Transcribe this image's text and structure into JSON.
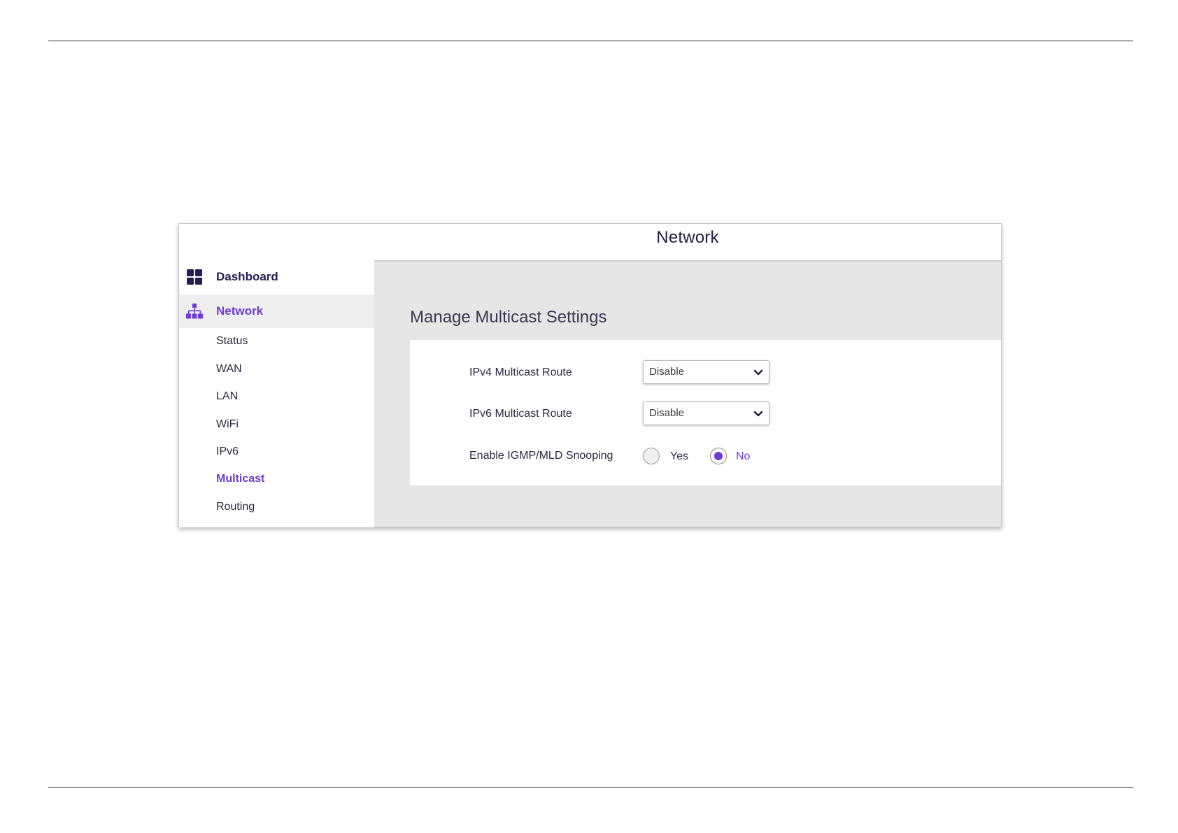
{
  "window": {
    "title": "Network"
  },
  "sidebar": {
    "items": [
      {
        "label": "Dashboard",
        "icon": "dashboard-grid-icon"
      },
      {
        "label": "Network",
        "icon": "network-tree-icon",
        "active": true
      }
    ],
    "subitems": [
      {
        "label": "Status"
      },
      {
        "label": "WAN"
      },
      {
        "label": "LAN"
      },
      {
        "label": "WiFi"
      },
      {
        "label": "IPv6"
      },
      {
        "label": "Multicast",
        "active": true
      },
      {
        "label": "Routing"
      }
    ]
  },
  "main": {
    "section_title": "Manage Multicast Settings",
    "ipv4": {
      "label": "IPv4 Multicast Route",
      "value": "Disable"
    },
    "ipv6": {
      "label": "IPv6 Multicast Route",
      "value": "Disable"
    },
    "snooping": {
      "label": "Enable IGMP/MLD Snooping",
      "options": [
        {
          "label": "Yes",
          "selected": false
        },
        {
          "label": "No",
          "selected": true
        }
      ]
    }
  },
  "colors": {
    "accent": "#6a3cd8",
    "nav_dark": "#231d56",
    "panel_bg": "#e6e6e6"
  }
}
